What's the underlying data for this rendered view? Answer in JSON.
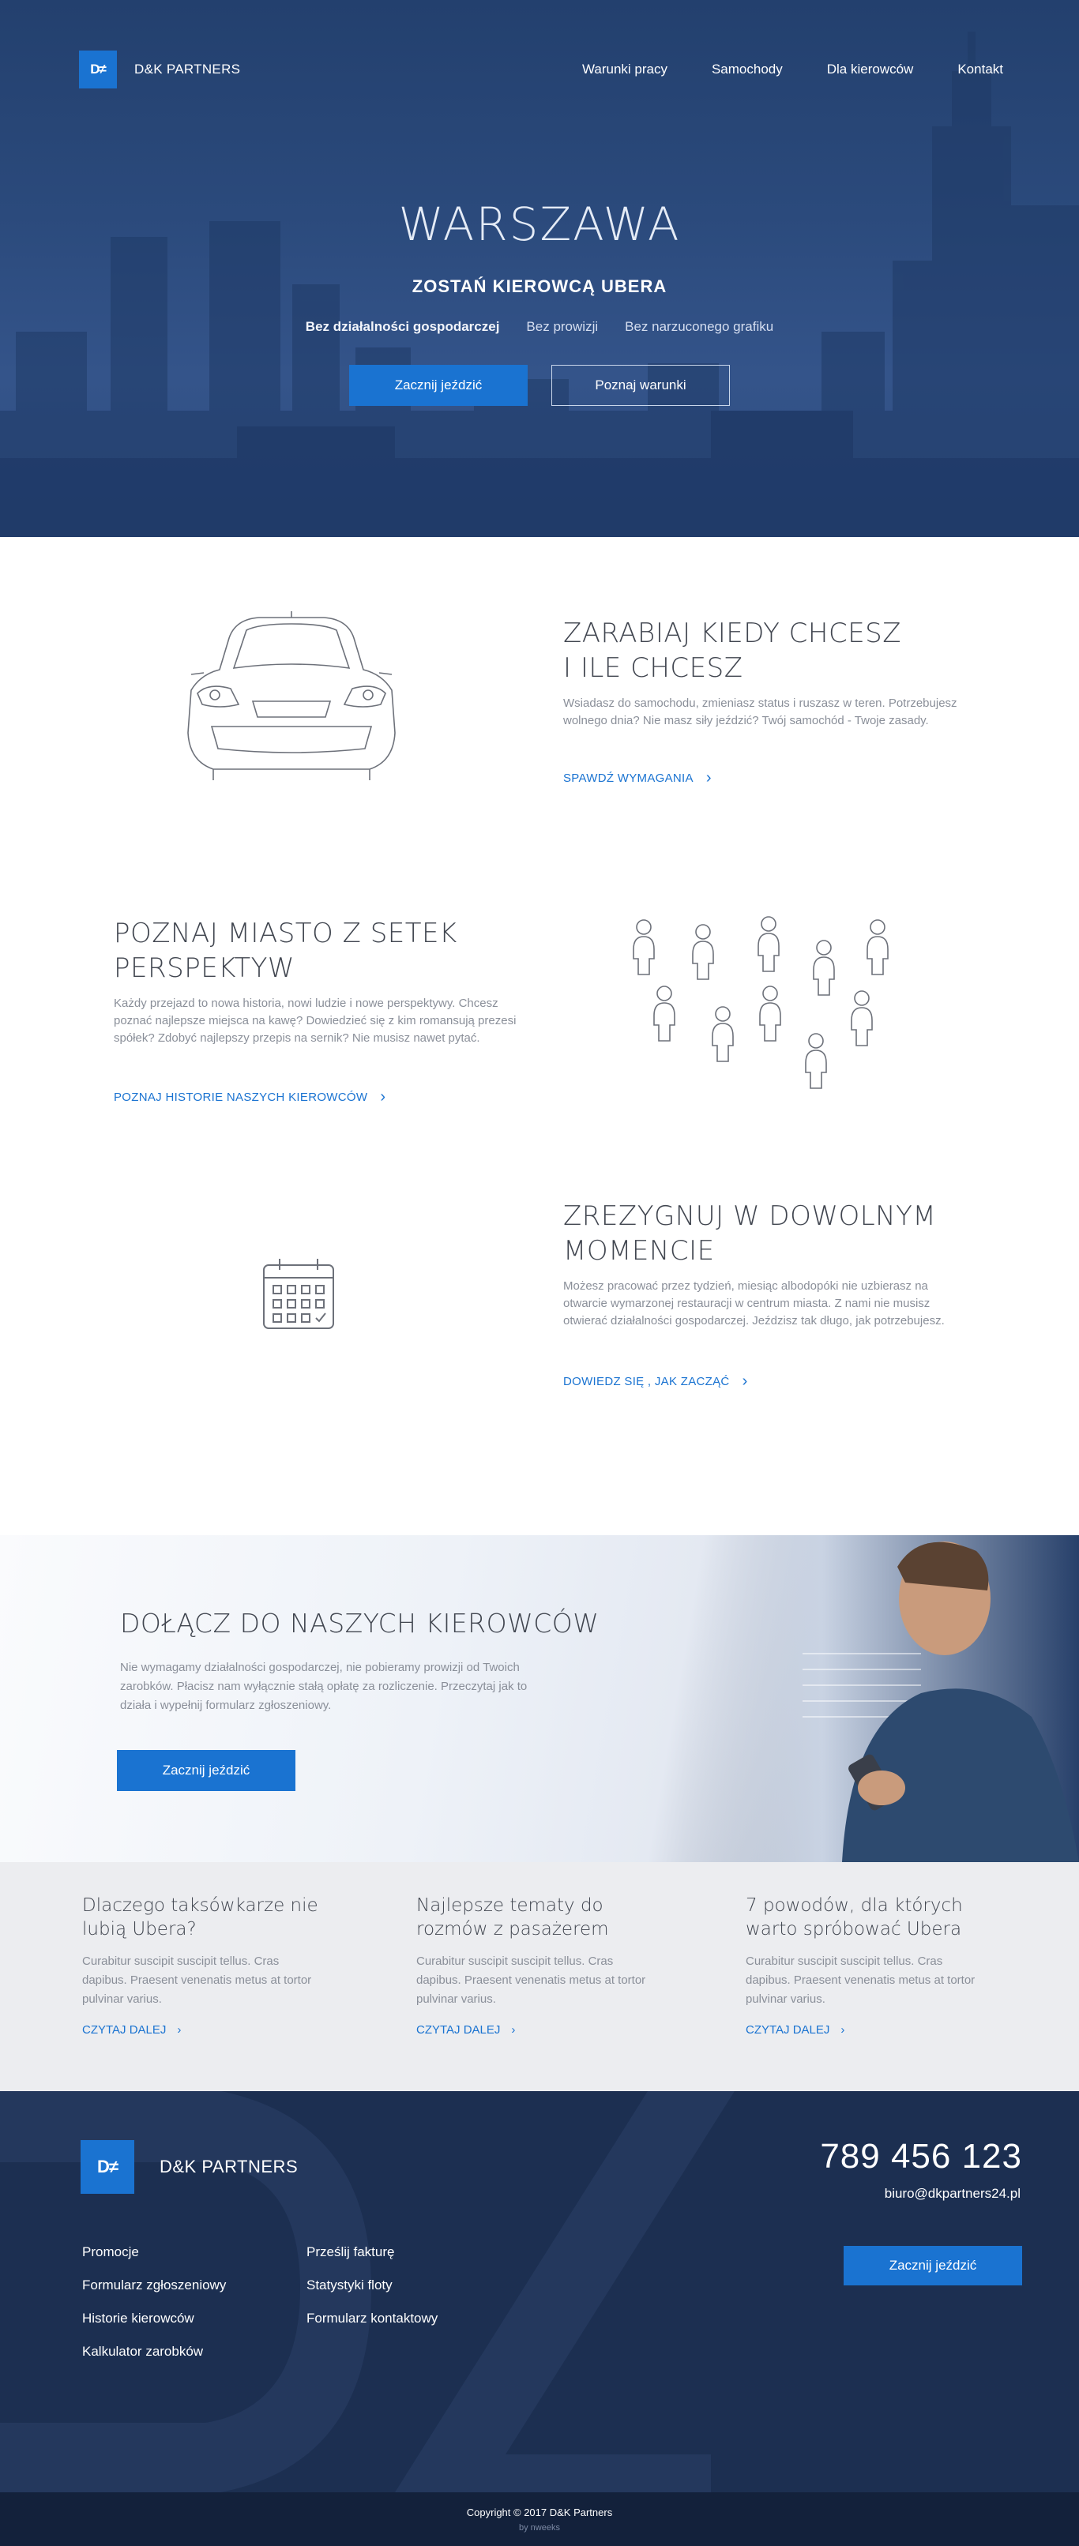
{
  "nav": {
    "brand": "D&K PARTNERS",
    "logo_text": "D≠",
    "links": [
      "Warunki pracy",
      "Samochody",
      "Dla kierowców",
      "Kontakt"
    ]
  },
  "hero": {
    "title": "WARSZAWA",
    "subtitle": "ZOSTAŃ KIEROWCĄ UBERA",
    "features": [
      "Bez działalności gospodarczej",
      "Bez prowizji",
      "Bez narzuconego grafiku"
    ],
    "primary_button": "Zacznij jeździć",
    "secondary_button": "Poznaj warunki"
  },
  "features": [
    {
      "title_line1": "ZARABIAJ KIEDY CHCESZ",
      "title_line2": "I ILE CHCESZ",
      "text": "Wsiadasz do samochodu, zmieniasz status i ruszasz w teren. Potrzebujesz wolnego dnia? Nie masz siły jeździć? Twój samochód - Twoje zasady.",
      "link": "SPAWDŹ WYMAGANIA",
      "icon": "car-icon"
    },
    {
      "title_line1": "POZNAJ MIASTO Z SETEK",
      "title_line2": "PERSPEKTYW",
      "text": "Każdy przejazd to nowa historia, nowi ludzie i nowe perspektywy. Chcesz poznać najlepsze miejsca na kawę? Dowiedzieć się z kim romansują prezesi spółek? Zdobyć najlepszy przepis na sernik? Nie musisz nawet pytać.",
      "link": "POZNAJ HISTORIE NASZYCH KIEROWCÓW",
      "icon": "people-icon"
    },
    {
      "title_line1": "ZREZYGNUJ W DOWOLNYM",
      "title_line2": "MOMENCIE",
      "text": "Możesz pracować przez tydzień, miesiąc albodopóki nie uzbierasz na otwarcie wymarzonej restauracji w centrum miasta. Z nami nie musisz otwierać działalności gospodarczej. Jeździsz tak długo, jak potrzebujesz.",
      "link": "DOWIEDZ SIĘ , JAK ZACZĄĆ",
      "icon": "calendar-icon"
    }
  ],
  "join": {
    "title": "DOŁĄCZ DO NASZYCH KIEROWCÓW",
    "text": "Nie wymagamy działalności gospodarczej, nie pobieramy prowizji od Twoich zarobków. Płacisz nam wyłącznie stałą opłatę za rozliczenie. Przeczytaj jak to działa i wypełnij formularz zgłoszeniowy.",
    "button": "Zacznij jeździć"
  },
  "articles": [
    {
      "title": "Dlaczego taksówkarze nie lubią Ubera?",
      "text": "Curabitur suscipit suscipit tellus. Cras dapibus. Praesent venenatis metus at tortor pulvinar varius.",
      "link": "CZYTAJ DALEJ"
    },
    {
      "title": "Najlepsze tematy do rozmów z pasażerem",
      "text": "Curabitur suscipit suscipit tellus. Cras dapibus. Praesent venenatis metus at tortor pulvinar varius.",
      "link": "CZYTAJ DALEJ"
    },
    {
      "title": "7 powodów, dla których warto spróbować Ubera",
      "text": "Curabitur suscipit suscipit tellus. Cras dapibus. Praesent venenatis metus at tortor pulvinar varius.",
      "link": "CZYTAJ DALEJ"
    }
  ],
  "footer": {
    "brand": "D&K PARTNERS",
    "phone": "789 456 123",
    "email": "biuro@dkpartners24.pl",
    "col1": [
      "Promocje",
      "Formularz zgłoszeniowy",
      "Historie kierowców",
      "Kalkulator zarobków"
    ],
    "col2": [
      "Prześlij fakturę",
      "Statystyki floty",
      "Formularz kontaktowy"
    ],
    "button": "Zacznij jeździć",
    "copyright": "Copyright © 2017 D&K Partners",
    "by": "by nweeks"
  },
  "colors": {
    "accent": "#1a73d1",
    "hero_bg": "#2b4a7c",
    "footer_bg": "#1c2f51",
    "articles_bg": "#ecedf0"
  }
}
